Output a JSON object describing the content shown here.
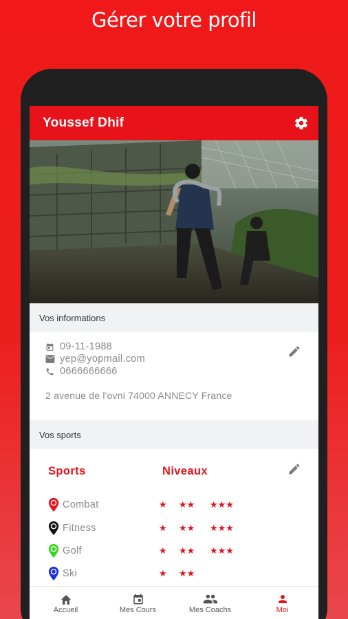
{
  "promo": {
    "title": "Gérer votre profil"
  },
  "header": {
    "user_name": "Youssef Dhif",
    "settings_icon": "gear-icon"
  },
  "info": {
    "section_title": "Vos informations",
    "birthdate": "09-11-1988",
    "email": "yep@yopmail.com",
    "phone": "0666666666",
    "address": "2 avenue de l'ovni 74000 ANNECY France"
  },
  "sports": {
    "section_title": "Vos sports",
    "col_sports": "Sports",
    "col_levels": "Niveaux",
    "items": [
      {
        "name": "Combat",
        "pin_color": "#e8121a",
        "level_groups": [
          1,
          2,
          3
        ]
      },
      {
        "name": "Fitness",
        "pin_color": "#111111",
        "level_groups": [
          1,
          2,
          3
        ]
      },
      {
        "name": "Golf",
        "pin_color": "#38d61c",
        "level_groups": [
          1,
          2,
          3
        ]
      },
      {
        "name": "Ski",
        "pin_color": "#1a2fe0",
        "level_groups": [
          1,
          2
        ]
      }
    ]
  },
  "nav": {
    "items": [
      {
        "label": "Accueil",
        "icon": "home-icon",
        "active": false
      },
      {
        "label": "Mes Cours",
        "icon": "calendar-icon",
        "active": false
      },
      {
        "label": "Mes Coachs",
        "icon": "people-icon",
        "active": false
      },
      {
        "label": "Moi",
        "icon": "person-icon",
        "active": true
      }
    ]
  },
  "colors": {
    "brand_red": "#e8121a",
    "text_gray": "#8a8a8a"
  }
}
